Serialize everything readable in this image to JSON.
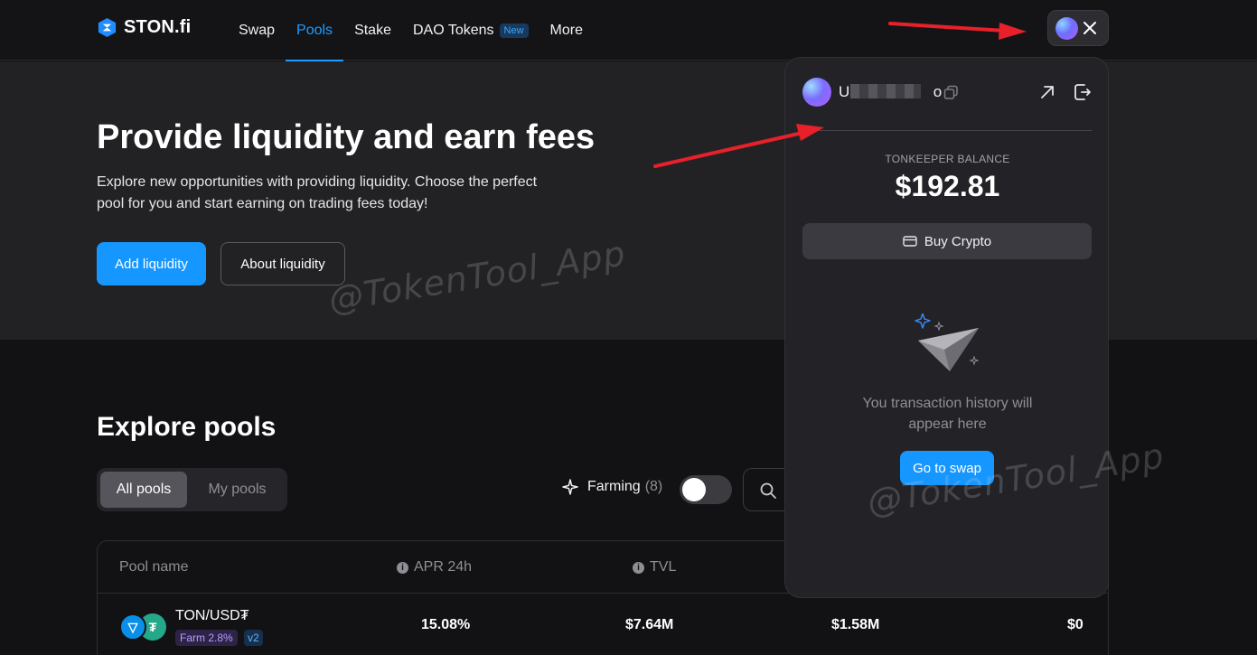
{
  "brand": {
    "name": "STON.fi"
  },
  "nav": {
    "items": [
      {
        "label": "Swap"
      },
      {
        "label": "Pools"
      },
      {
        "label": "Stake"
      },
      {
        "label": "DAO Tokens",
        "badge": "New"
      },
      {
        "label": "More"
      }
    ],
    "active": "Pools"
  },
  "hero": {
    "title": "Provide liquidity and earn fees",
    "description": "Explore new opportunities with providing liquidity. Choose the perfect pool for you and start earning on trading fees today!",
    "primary_button": "Add liquidity",
    "secondary_button": "About liquidity"
  },
  "watermark": "@TokenTool_App",
  "explore": {
    "title": "Explore pools",
    "tabs": [
      {
        "label": "All pools",
        "active": true
      },
      {
        "label": "My pools",
        "active": false
      }
    ],
    "farming_label": "Farming",
    "farming_count": "(8)",
    "farming_toggle_on": false
  },
  "table": {
    "headers": {
      "pool_name": "Pool name",
      "apr": "APR 24h",
      "tvl": "TVL"
    },
    "rows": [
      {
        "pair": "TON/USD₮",
        "farm_tag": "Farm 2.8%",
        "version": "v2",
        "apr": "15.08%",
        "tvl": "$7.64M",
        "volume": "$1.58M",
        "fees": "$0"
      }
    ]
  },
  "wallet_panel": {
    "address_start": "U",
    "address_end": "o",
    "balance_label": "TONKEEPER BALANCE",
    "balance": "$192.81",
    "buy_button": "Buy Crypto",
    "empty_line1": "You transaction history will",
    "empty_line2": "appear here",
    "swap_button": "Go to swap"
  },
  "colors": {
    "accent": "#1697ff",
    "background": "#121214",
    "hero_bg": "#222225",
    "panel_bg": "#232327",
    "annotation_arrow": "#e8202a"
  },
  "icons": [
    "ston-logo-icon",
    "wallet-avatar-icon",
    "close-icon",
    "copy-icon",
    "external-link-icon",
    "logout-icon",
    "card-icon",
    "paper-plane-icon",
    "sparkle-icon",
    "search-icon",
    "info-icon",
    "ton-coin-icon",
    "usdt-coin-icon"
  ]
}
